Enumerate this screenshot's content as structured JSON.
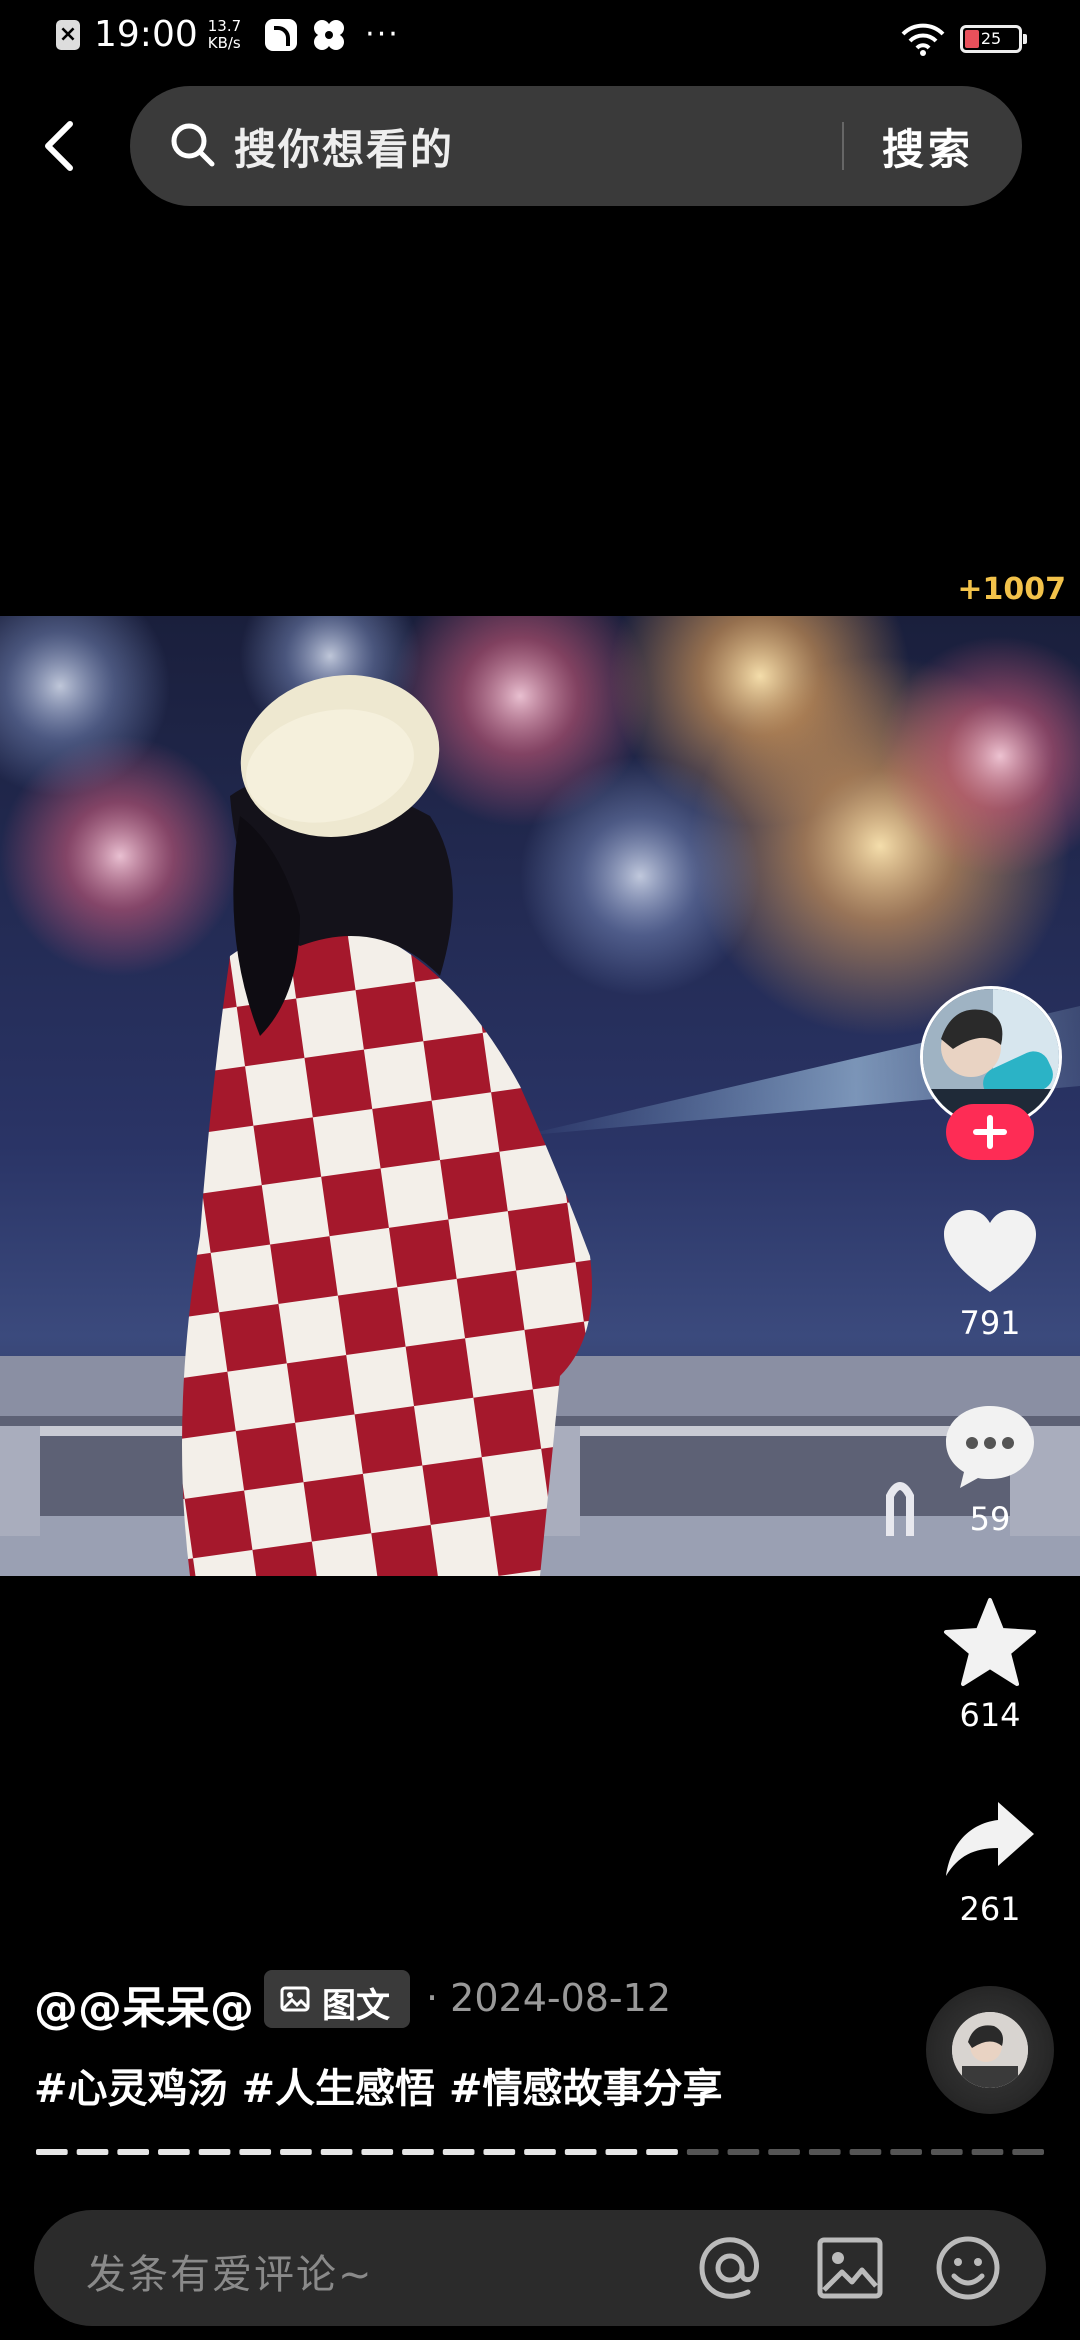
{
  "status_bar": {
    "time": "19:00",
    "net_speed_value": "13.7",
    "net_speed_unit": "KB/s",
    "more": "···",
    "battery": "25"
  },
  "search": {
    "placeholder": "搜你想看的",
    "button_label": "搜索"
  },
  "reward": {
    "count": "+1007"
  },
  "actions": {
    "like_count": "791",
    "comment_count": "59",
    "favorite_count": "614",
    "share_count": "261"
  },
  "post": {
    "author": "@@呆呆@",
    "type_label": "图文",
    "date": "· 2024-08-12",
    "hashtags": [
      "#心灵鸡汤",
      "#人生感悟",
      "#情感故事分享"
    ],
    "progress": {
      "total_segments": 25,
      "completed_segments": 16
    }
  },
  "comment_bar": {
    "placeholder": "发条有爱评论~"
  },
  "colors": {
    "accent": "#fe2c55",
    "reward": "#f2c24a",
    "envelope": "#e8262a"
  }
}
